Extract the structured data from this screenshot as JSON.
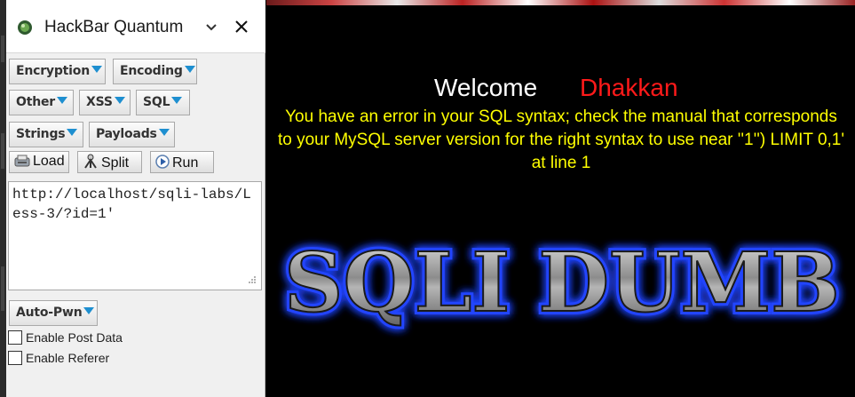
{
  "sidebar": {
    "title": "HackBar Quantum",
    "menus": {
      "encryption": "Encryption",
      "encoding": "Encoding",
      "other": "Other",
      "xss": "XSS",
      "sql": "SQL",
      "strings": "Strings",
      "payloads": "Payloads"
    },
    "toolbar": {
      "load": "Load",
      "split": "Split",
      "run": "Run"
    },
    "url_value": "http://localhost/sqli-labs/Less-3/?id=1'",
    "auto_pwn": "Auto-Pwn",
    "options": [
      {
        "label": "Enable Post Data",
        "checked": false
      },
      {
        "label": "Enable Referer",
        "checked": false
      }
    ]
  },
  "page": {
    "welcome": "Welcome",
    "username": "Dhakkan",
    "error": "You have an error in your SQL syntax; check the manual that corresponds to your MySQL server version for the right syntax to use near ''1'') LIMIT 0,1' at line 1",
    "banner": "SQLI DUMB"
  },
  "colors": {
    "accent_triangle": "#1e8fd0",
    "error_text": "#ffff00",
    "username_text": "#ff1a1a",
    "banner_glow": "#2244ff"
  }
}
